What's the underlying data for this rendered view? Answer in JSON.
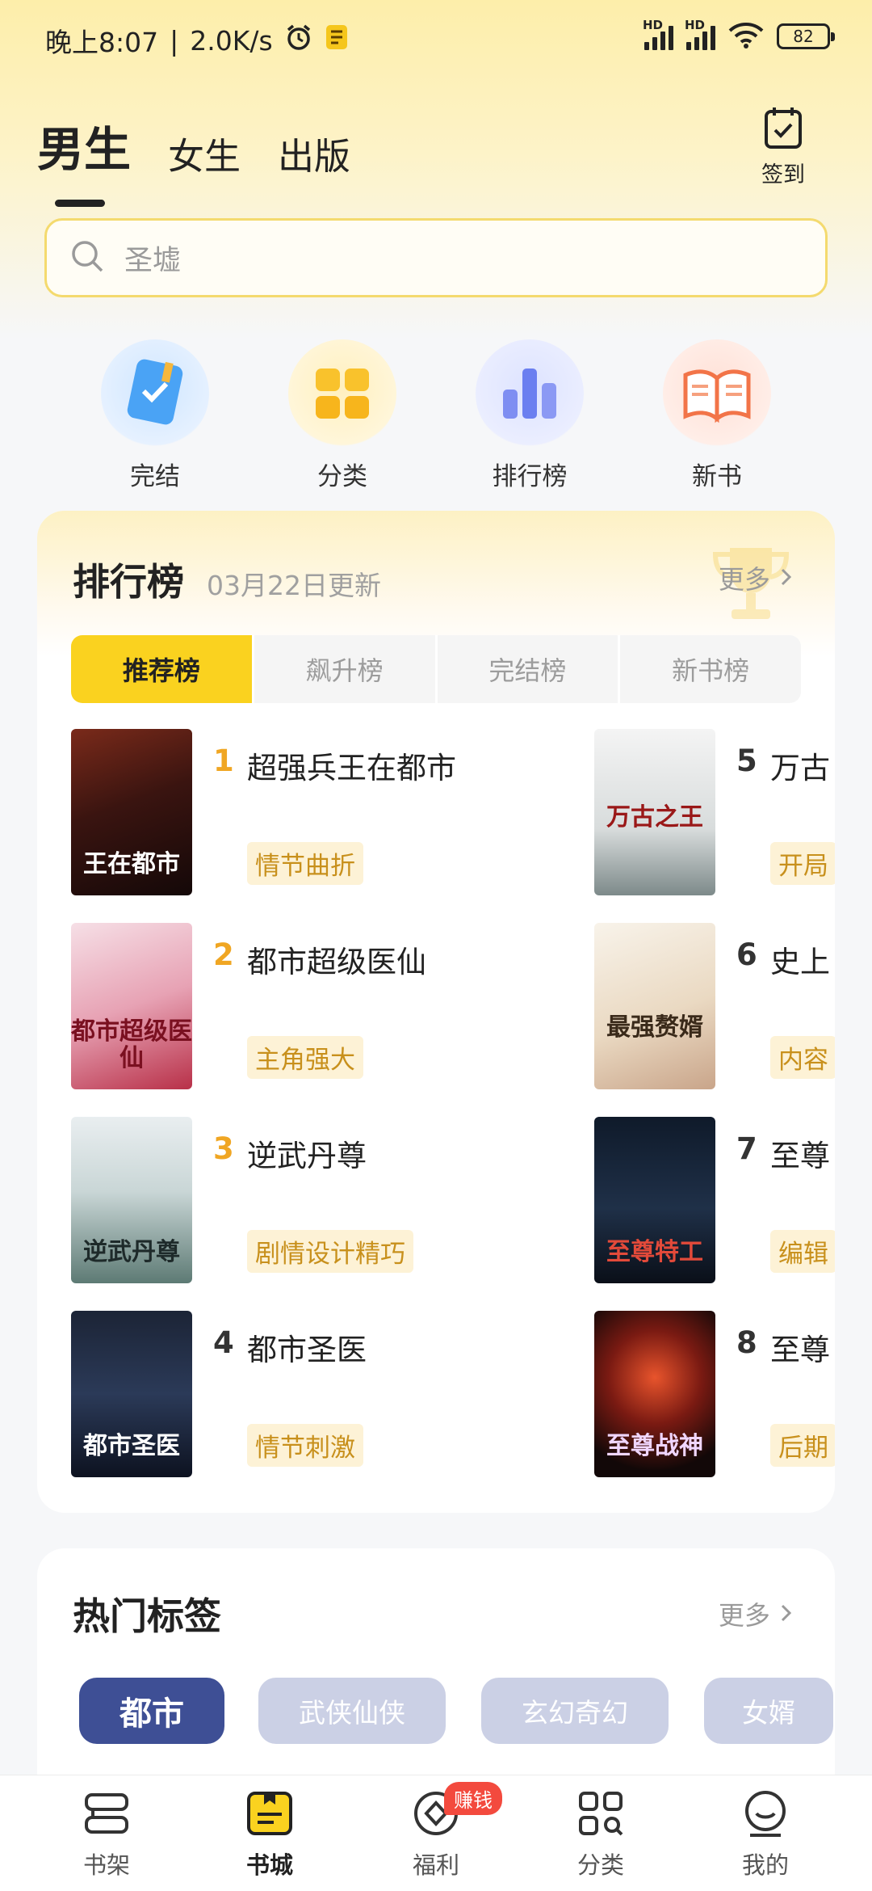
{
  "status_bar": {
    "time": "晚上8:07",
    "speed": "2.0K/s",
    "battery": "82"
  },
  "header": {
    "tabs": [
      "男生",
      "女生",
      "出版"
    ],
    "checkin_label": "签到"
  },
  "search": {
    "placeholder": "圣墟"
  },
  "quick_entries": [
    {
      "label": "完结",
      "icon": "book-check-icon"
    },
    {
      "label": "分类",
      "icon": "grid-icon"
    },
    {
      "label": "排行榜",
      "icon": "bar-chart-icon"
    },
    {
      "label": "新书",
      "icon": "open-book-icon"
    }
  ],
  "ranking": {
    "title": "排行榜",
    "update_date": "03月22日更新",
    "more": "更多",
    "tabs": [
      "推荐榜",
      "飙升榜",
      "完结榜",
      "新书榜"
    ],
    "books": [
      {
        "rank": "1",
        "title": "超强兵王在都市",
        "tag": "情节曲折",
        "cover_text": "王在都市"
      },
      {
        "rank": "2",
        "title": "都市超级医仙",
        "tag": "主角强大",
        "cover_text": "都市超级医仙"
      },
      {
        "rank": "3",
        "title": "逆武丹尊",
        "tag": "剧情设计精巧",
        "cover_text": "逆武丹尊"
      },
      {
        "rank": "4",
        "title": "都市圣医",
        "tag": "情节刺激",
        "cover_text": "都市圣医"
      },
      {
        "rank": "5",
        "title": "万古",
        "tag": "开局",
        "cover_text": "万古之王"
      },
      {
        "rank": "6",
        "title": "史上",
        "tag": "内容",
        "cover_text": "最强赘婿"
      },
      {
        "rank": "7",
        "title": "至尊",
        "tag": "编辑",
        "cover_text": "至尊特工"
      },
      {
        "rank": "8",
        "title": "至尊",
        "tag": "后期",
        "cover_text": "至尊战神"
      }
    ]
  },
  "hot_tags": {
    "title": "热门标签",
    "more": "更多",
    "tags": [
      "都市",
      "武侠仙侠",
      "玄幻奇幻",
      "女婿"
    ]
  },
  "bottom_nav": {
    "items": [
      "书架",
      "书城",
      "福利",
      "分类",
      "我的"
    ],
    "badge": "赚钱",
    "active": "书城"
  },
  "colors": {
    "accent_yellow": "#fad21f",
    "rank_number": "#f0a623",
    "tag_text": "#c8901c",
    "hot_tag_active": "#3e4f95"
  }
}
